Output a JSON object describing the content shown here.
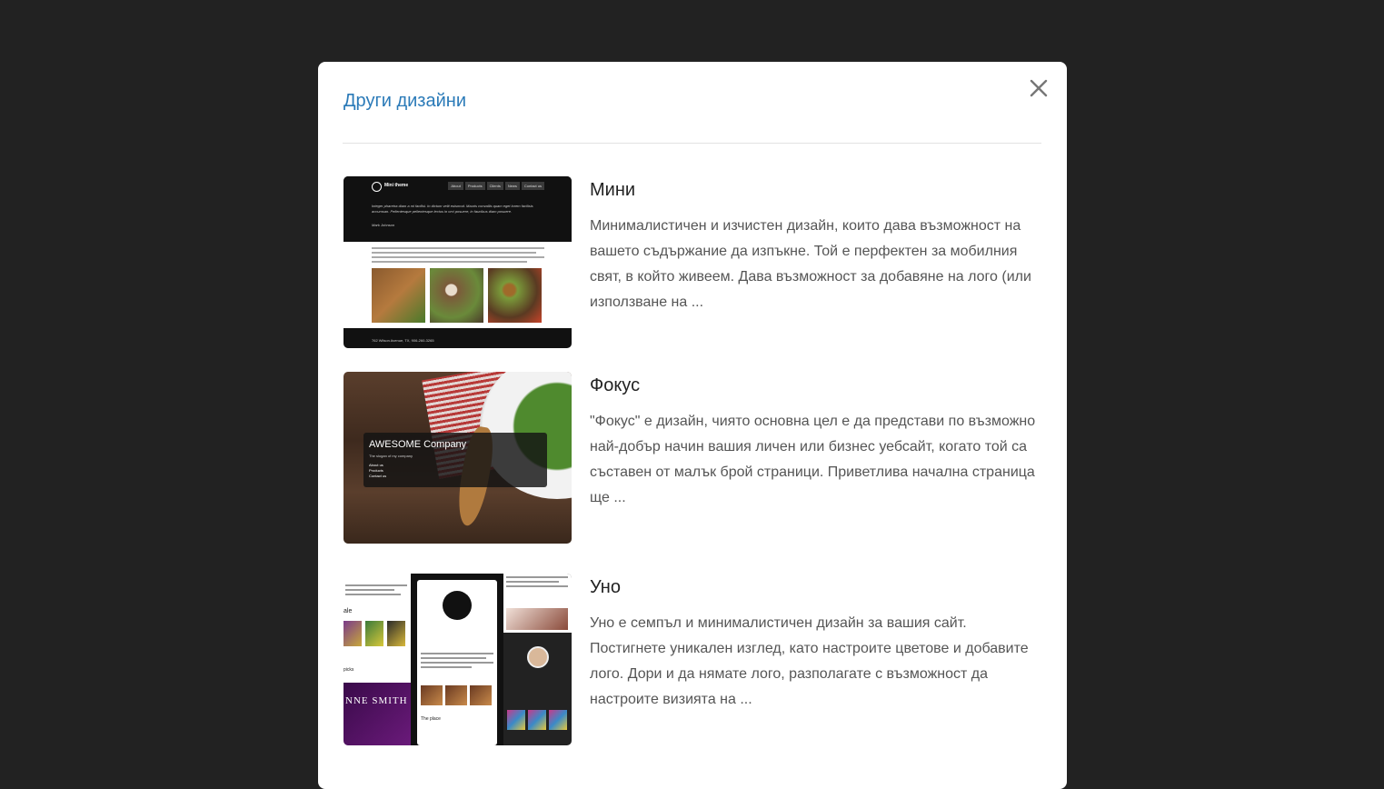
{
  "modal": {
    "title": "Други дизайни",
    "close_icon": "close-icon"
  },
  "designs": [
    {
      "title": "Мини",
      "description": "Минималистичен и изчистен дизайн, които дава възможност на вашето съдържание да изпъкне. Той е перфектен за мобилния свят, в който живеем. Дава възможност за добавяне на лого (или използване на ...",
      "thumb": {
        "brand": "Mini theme",
        "nav": [
          "About",
          "Products",
          "Clients",
          "News",
          "Contact us"
        ],
        "quote": "Integer pharetra diam a mi facilisi. In dictum velit euismod. Mauris convallis quam eget lorem facilisis accumsan. Pellentesque pellentesque lectus in orci posuere, in faucibus diam posuere.",
        "signature": "Mark Johnson",
        "footer": "762 Wilson Avenue, TX, 906-260-3265"
      }
    },
    {
      "title": "Фокус",
      "description": "\"Фокус\" е дизайн, чиято основна цел е да представи по възможно най-добър начин вашия личен или бизнес уебсайт, когато той са съставен от малък брой страници. Приветлива начална страница ще ...",
      "thumb": {
        "company": "AWESOME Company",
        "slogan": "The slogan of my company",
        "links": [
          "About us",
          "Products",
          "Contact us"
        ]
      }
    },
    {
      "title": "Уно",
      "description": "Уно е семпъл и минималистичен дизайн за вашия сайт. Постигнете уникален изглед, като настроите цветове и добавите лого. Дори и да нямате лого, разполагате с възможност да настроите визията на ...",
      "thumb": {
        "sale": "ale",
        "picks": "picks",
        "banner": "NNE SMITH",
        "place": "The place"
      }
    }
  ]
}
